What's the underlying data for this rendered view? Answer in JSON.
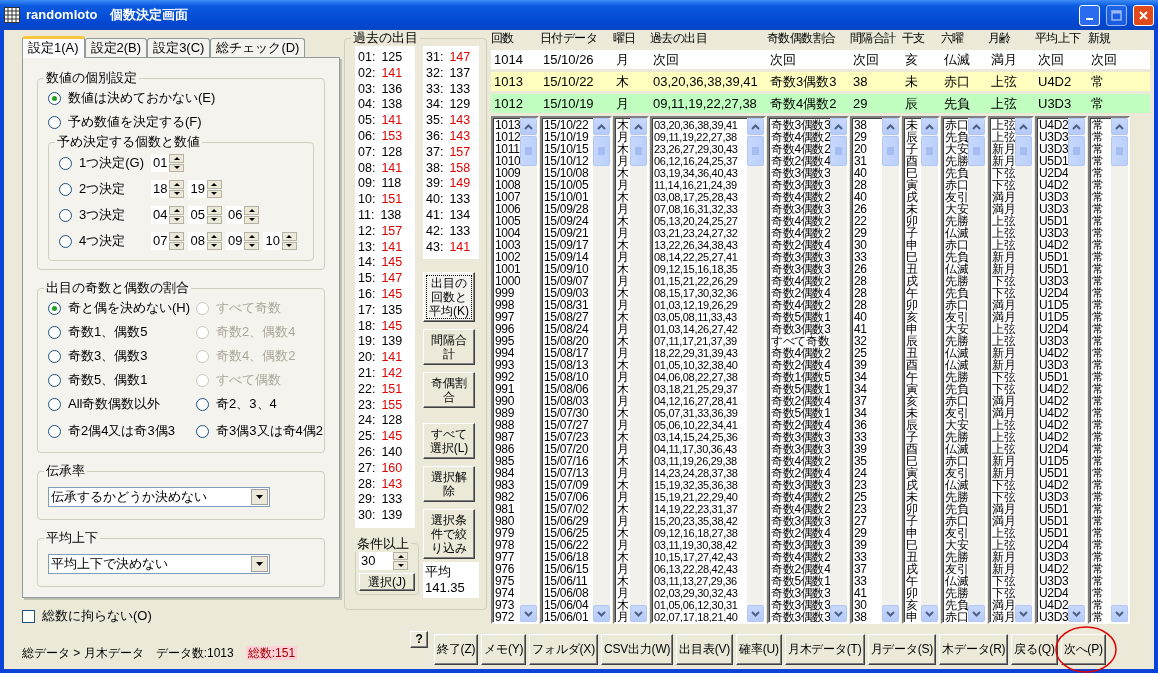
{
  "window": {
    "title": "randomloto　個数決定画面"
  },
  "tabs": [
    {
      "label": "設定1(A)",
      "selected": true
    },
    {
      "label": "設定2(B)",
      "selected": false
    },
    {
      "label": "設定3(C)",
      "selected": false
    },
    {
      "label": "総チェック(D)",
      "selected": false
    }
  ],
  "individual_settings": {
    "title": "数値の個別設定",
    "options": [
      {
        "label": "数値は決めておかない(E)",
        "checked": true
      },
      {
        "label": "予め数値を決定する(F)",
        "checked": false
      }
    ],
    "preset": {
      "title": "予め決定する個数と数値",
      "rows": [
        {
          "label": "1つ決定(G)",
          "checked": false,
          "values": [
            "01"
          ]
        },
        {
          "label": "2つ決定",
          "checked": false,
          "values": [
            "18",
            "19"
          ]
        },
        {
          "label": "3つ決定",
          "checked": false,
          "values": [
            "04",
            "05",
            "06"
          ]
        },
        {
          "label": "4つ決定",
          "checked": false,
          "values": [
            "07",
            "08",
            "09",
            "10"
          ]
        }
      ]
    }
  },
  "odd_even": {
    "title": "出目の奇数と偶数の割合",
    "options": [
      {
        "label": "奇と偶を決めない(H)",
        "checked": true,
        "disabled": false
      },
      {
        "label": "すべて奇数",
        "checked": false,
        "disabled": true
      },
      {
        "label": "奇数1、偶数5",
        "checked": false,
        "disabled": false
      },
      {
        "label": "奇数2、偶数4",
        "checked": false,
        "disabled": true
      },
      {
        "label": "奇数3、偶数3",
        "checked": false,
        "disabled": false
      },
      {
        "label": "奇数4、偶数2",
        "checked": false,
        "disabled": true
      },
      {
        "label": "奇数5、偶数1",
        "checked": false,
        "disabled": false
      },
      {
        "label": "すべて偶数",
        "checked": false,
        "disabled": true
      },
      {
        "label": "All奇数偶数以外",
        "checked": false,
        "disabled": false
      },
      {
        "label": "奇2、3、4",
        "checked": false,
        "disabled": false
      },
      {
        "label": "奇2偶4又は奇3偶3",
        "checked": false,
        "disabled": false
      },
      {
        "label": "奇3偶3又は奇4偶2",
        "checked": false,
        "disabled": false
      }
    ]
  },
  "inheritance": {
    "title": "伝承率",
    "value": "伝承するかどうか決めない"
  },
  "average_updown": {
    "title": "平均上下",
    "value": "平均上下で決めない"
  },
  "ignore_total": {
    "label": "総数に拘らない(O)",
    "checked": false
  },
  "status": {
    "path": "総データ > 月木データ",
    "data_count": "データ数:1013",
    "total": "総数:151"
  },
  "past_numbers": {
    "title": "過去の出目",
    "left_items": [
      {
        "label": "01:",
        "value": "125",
        "high": false
      },
      {
        "label": "02:",
        "value": "141",
        "high": true
      },
      {
        "label": "03:",
        "value": "136",
        "high": false
      },
      {
        "label": "04:",
        "value": "138",
        "high": false
      },
      {
        "label": "05:",
        "value": "141",
        "high": true
      },
      {
        "label": "06:",
        "value": "153",
        "high": true
      },
      {
        "label": "07:",
        "value": "128",
        "high": false
      },
      {
        "label": "08:",
        "value": "141",
        "high": true
      },
      {
        "label": "09:",
        "value": "118",
        "high": false
      },
      {
        "label": "10:",
        "value": "151",
        "high": true
      },
      {
        "label": "11:",
        "value": "138",
        "high": false
      },
      {
        "label": "12:",
        "value": "157",
        "high": true
      },
      {
        "label": "13:",
        "value": "141",
        "high": true
      },
      {
        "label": "14:",
        "value": "145",
        "high": true
      },
      {
        "label": "15:",
        "value": "147",
        "high": true
      },
      {
        "label": "16:",
        "value": "145",
        "high": true
      },
      {
        "label": "17:",
        "value": "135",
        "high": false
      },
      {
        "label": "18:",
        "value": "145",
        "high": true
      },
      {
        "label": "19:",
        "value": "139",
        "high": false
      },
      {
        "label": "20:",
        "value": "141",
        "high": true
      },
      {
        "label": "21:",
        "value": "142",
        "high": true
      },
      {
        "label": "22:",
        "value": "151",
        "high": true
      },
      {
        "label": "23:",
        "value": "155",
        "high": true
      },
      {
        "label": "24:",
        "value": "128",
        "high": false
      },
      {
        "label": "25:",
        "value": "145",
        "high": true
      },
      {
        "label": "26:",
        "value": "140",
        "high": false
      },
      {
        "label": "27:",
        "value": "160",
        "high": true
      },
      {
        "label": "28:",
        "value": "143",
        "high": true
      },
      {
        "label": "29:",
        "value": "133",
        "high": false
      },
      {
        "label": "30:",
        "value": "139",
        "high": false
      }
    ],
    "right_items": [
      {
        "label": "31:",
        "value": "147",
        "high": true
      },
      {
        "label": "32:",
        "value": "137",
        "high": false
      },
      {
        "label": "33:",
        "value": "133",
        "high": false
      },
      {
        "label": "34:",
        "value": "129",
        "high": false
      },
      {
        "label": "35:",
        "value": "143",
        "high": true
      },
      {
        "label": "36:",
        "value": "143",
        "high": true
      },
      {
        "label": "37:",
        "value": "157",
        "high": true
      },
      {
        "label": "38:",
        "value": "158",
        "high": true
      },
      {
        "label": "39:",
        "value": "149",
        "high": true
      },
      {
        "label": "40:",
        "value": "133",
        "high": false
      },
      {
        "label": "41:",
        "value": "134",
        "high": false
      },
      {
        "label": "42:",
        "value": "133",
        "high": false
      },
      {
        "label": "43:",
        "value": "141",
        "high": true
      }
    ]
  },
  "side_buttons": [
    {
      "label": "出目の回数と平均(K)",
      "focused": true
    },
    {
      "label": "間隔合計",
      "focused": false
    },
    {
      "label": "奇偶割合",
      "focused": false
    },
    {
      "label": "すべて選択(L)",
      "focused": false
    },
    {
      "label": "選択解除",
      "focused": false
    },
    {
      "label": "選択条件で絞り込み",
      "focused": false
    }
  ],
  "threshold": {
    "title": "条件以上",
    "value": "30",
    "button": "選択(J)"
  },
  "average": {
    "label": "平均",
    "value": "141.35"
  },
  "table": {
    "columns": [
      "回数",
      "日付データ",
      "曜日",
      "過去の出目",
      "奇数偶数割合",
      "間隔合計",
      "干支",
      "六曜",
      "月齢",
      "平均上下",
      "新規"
    ],
    "top_rows": [
      {
        "color": "#ffffff",
        "cells": [
          "1014",
          "15/10/26",
          "月",
          "次回",
          "次回",
          "次回",
          "亥",
          "仏滅",
          "満月",
          "次回",
          "次回"
        ]
      },
      {
        "color": "#ffffc0",
        "cells": [
          "1013",
          "15/10/22",
          "木",
          "03,20,36,38,39,41",
          "奇数3偶数3",
          "38",
          "未",
          "赤口",
          "上弦",
          "U4D2",
          "常"
        ]
      },
      {
        "color": "#c0ffc0",
        "cells": [
          "1012",
          "15/10/19",
          "月",
          "09,11,19,22,27,38",
          "奇数4偶数2",
          "29",
          "辰",
          "先負",
          "上弦",
          "U3D3",
          "常"
        ]
      }
    ],
    "rows": [
      [
        "1013",
        "15/10/22",
        "木",
        "03,20,36,38,39,41",
        "奇数3偶数3",
        "38",
        "未",
        "赤口",
        "上弦",
        "U4D2",
        "常"
      ],
      [
        "1012",
        "15/10/19",
        "月",
        "09,11,19,22,27,38",
        "奇数4偶数2",
        "29",
        "辰",
        "先負",
        "上弦",
        "U3D3",
        "常"
      ],
      [
        "1011",
        "15/10/15",
        "木",
        "23,26,27,29,30,43",
        "奇数4偶数2",
        "20",
        "子",
        "大安",
        "新月",
        "U3D3",
        "常"
      ],
      [
        "1010",
        "15/10/12",
        "月",
        "06,12,16,24,25,37",
        "奇数2偶数4",
        "31",
        "酉",
        "先勝",
        "新月",
        "U5D1",
        "常"
      ],
      [
        "1009",
        "15/10/08",
        "木",
        "03,19,34,36,40,43",
        "奇数3偶数3",
        "40",
        "巳",
        "先負",
        "下弦",
        "U2D4",
        "常"
      ],
      [
        "1008",
        "15/10/05",
        "月",
        "11,14,16,21,24,39",
        "奇数3偶数3",
        "28",
        "寅",
        "赤口",
        "下弦",
        "U4D2",
        "常"
      ],
      [
        "1007",
        "15/10/01",
        "木",
        "03,08,17,25,28,43",
        "奇数4偶数2",
        "40",
        "戌",
        "友引",
        "満月",
        "U3D3",
        "常"
      ],
      [
        "1006",
        "15/09/28",
        "月",
        "07,08,16,31,32,33",
        "奇数3偶数3",
        "26",
        "未",
        "大安",
        "満月",
        "U3D3",
        "常"
      ],
      [
        "1005",
        "15/09/24",
        "木",
        "05,13,20,24,25,27",
        "奇数4偶数2",
        "22",
        "卯",
        "先勝",
        "上弦",
        "U5D1",
        "常"
      ],
      [
        "1004",
        "15/09/21",
        "月",
        "03,21,23,24,27,32",
        "奇数4偶数2",
        "29",
        "子",
        "仏滅",
        "上弦",
        "U3D3",
        "常"
      ],
      [
        "1003",
        "15/09/17",
        "木",
        "13,22,26,34,38,43",
        "奇数2偶数4",
        "30",
        "申",
        "赤口",
        "上弦",
        "U4D2",
        "常"
      ],
      [
        "1002",
        "15/09/14",
        "月",
        "08,14,22,25,27,41",
        "奇数3偶数3",
        "33",
        "巳",
        "先負",
        "新月",
        "U5D1",
        "常"
      ],
      [
        "1001",
        "15/09/10",
        "木",
        "09,12,15,16,18,35",
        "奇数3偶数3",
        "26",
        "丑",
        "仏滅",
        "新月",
        "U5D1",
        "常"
      ],
      [
        "1000",
        "15/09/07",
        "月",
        "01,15,21,22,26,29",
        "奇数4偶数2",
        "28",
        "戌",
        "先勝",
        "下弦",
        "U3D3",
        "常"
      ],
      [
        "999",
        "15/09/03",
        "木",
        "08,15,17,30,32,36",
        "奇数2偶数4",
        "28",
        "午",
        "先負",
        "下弦",
        "U2D4",
        "常"
      ],
      [
        "998",
        "15/08/31",
        "月",
        "01,03,12,19,26,29",
        "奇数4偶数2",
        "28",
        "卯",
        "赤口",
        "満月",
        "U1D5",
        "常"
      ],
      [
        "997",
        "15/08/27",
        "木",
        "03,05,08,11,33,43",
        "奇数5偶数1",
        "40",
        "亥",
        "友引",
        "満月",
        "U1D5",
        "常"
      ],
      [
        "996",
        "15/08/24",
        "月",
        "01,03,14,26,27,42",
        "奇数3偶数3",
        "41",
        "申",
        "大安",
        "上弦",
        "U2D4",
        "常"
      ],
      [
        "995",
        "15/08/20",
        "木",
        "07,11,17,21,37,39",
        "すべて奇数",
        "32",
        "辰",
        "先勝",
        "上弦",
        "U3D3",
        "常"
      ],
      [
        "994",
        "15/08/17",
        "月",
        "18,22,29,31,39,43",
        "奇数4偶数2",
        "25",
        "丑",
        "仏滅",
        "新月",
        "U4D2",
        "常"
      ],
      [
        "993",
        "15/08/13",
        "木",
        "01,05,10,32,38,40",
        "奇数2偶数4",
        "39",
        "酉",
        "仏滅",
        "新月",
        "U3D3",
        "常"
      ],
      [
        "992",
        "15/08/10",
        "月",
        "04,06,08,22,27,38",
        "奇数1偶数5",
        "34",
        "午",
        "先勝",
        "下弦",
        "U5D1",
        "常"
      ],
      [
        "991",
        "15/08/06",
        "木",
        "03,18,21,25,29,37",
        "奇数5偶数1",
        "34",
        "寅",
        "先負",
        "下弦",
        "U4D2",
        "常"
      ],
      [
        "990",
        "15/08/03",
        "月",
        "04,12,16,27,28,41",
        "奇数2偶数4",
        "37",
        "亥",
        "赤口",
        "満月",
        "U4D2",
        "常"
      ],
      [
        "989",
        "15/07/30",
        "木",
        "05,07,31,33,36,39",
        "奇数5偶数1",
        "34",
        "未",
        "友引",
        "満月",
        "U4D2",
        "常"
      ],
      [
        "988",
        "15/07/27",
        "月",
        "05,06,10,22,34,41",
        "奇数2偶数4",
        "36",
        "辰",
        "大安",
        "上弦",
        "U4D2",
        "常"
      ],
      [
        "987",
        "15/07/23",
        "木",
        "03,14,15,24,25,36",
        "奇数3偶数3",
        "33",
        "子",
        "先勝",
        "上弦",
        "U4D2",
        "常"
      ],
      [
        "986",
        "15/07/20",
        "月",
        "04,11,17,30,36,43",
        "奇数3偶数3",
        "39",
        "酉",
        "仏滅",
        "上弦",
        "U2D4",
        "常"
      ],
      [
        "985",
        "15/07/16",
        "木",
        "03,11,19,26,29,38",
        "奇数4偶数2",
        "35",
        "巳",
        "赤口",
        "新月",
        "U1D5",
        "常"
      ],
      [
        "984",
        "15/07/13",
        "月",
        "14,23,24,28,37,38",
        "奇数2偶数4",
        "24",
        "寅",
        "友引",
        "新月",
        "U5D1",
        "常"
      ],
      [
        "983",
        "15/07/09",
        "木",
        "15,19,32,35,36,38",
        "奇数3偶数3",
        "23",
        "戌",
        "仏滅",
        "下弦",
        "U4D2",
        "常"
      ],
      [
        "982",
        "15/07/06",
        "月",
        "15,19,21,22,29,40",
        "奇数4偶数2",
        "25",
        "未",
        "先勝",
        "下弦",
        "U3D3",
        "常"
      ],
      [
        "981",
        "15/07/02",
        "木",
        "14,19,22,23,31,37",
        "奇数4偶数2",
        "23",
        "卯",
        "先負",
        "満月",
        "U5D1",
        "常"
      ],
      [
        "980",
        "15/06/29",
        "月",
        "15,20,23,35,38,42",
        "奇数3偶数3",
        "27",
        "子",
        "赤口",
        "満月",
        "U5D1",
        "常"
      ],
      [
        "979",
        "15/06/25",
        "木",
        "09,12,16,18,27,38",
        "奇数2偶数4",
        "29",
        "申",
        "友引",
        "上弦",
        "U5D1",
        "常"
      ],
      [
        "978",
        "15/06/22",
        "月",
        "03,11,19,30,38,42",
        "奇数3偶数3",
        "39",
        "巳",
        "大安",
        "上弦",
        "U2D4",
        "常"
      ],
      [
        "977",
        "15/06/18",
        "木",
        "10,15,17,27,42,43",
        "奇数4偶数2",
        "33",
        "丑",
        "先勝",
        "新月",
        "U3D3",
        "常"
      ],
      [
        "976",
        "15/06/15",
        "月",
        "06,13,22,28,42,43",
        "奇数2偶数4",
        "37",
        "戌",
        "友引",
        "新月",
        "U4D2",
        "常"
      ],
      [
        "975",
        "15/06/11",
        "木",
        "03,11,13,27,29,36",
        "奇数5偶数1",
        "33",
        "午",
        "仏滅",
        "下弦",
        "U3D3",
        "常"
      ],
      [
        "974",
        "15/06/08",
        "月",
        "02,03,29,30,32,43",
        "奇数3偶数3",
        "41",
        "卯",
        "先勝",
        "下弦",
        "U2D4",
        "常"
      ],
      [
        "973",
        "15/06/04",
        "木",
        "01,05,06,12,30,31",
        "奇数3偶数3",
        "30",
        "亥",
        "先負",
        "満月",
        "U4D2",
        "常"
      ],
      [
        "972",
        "15/06/01",
        "月",
        "02,07,17,18,21,40",
        "奇数3偶数3",
        "38",
        "申",
        "赤口",
        "満月",
        "U3D3",
        "常"
      ]
    ]
  },
  "bottom_buttons": [
    {
      "label": "?",
      "kind": "help",
      "circled": false
    },
    {
      "label": "終了(Z)",
      "kind": "command",
      "circled": false
    },
    {
      "label": "メモ(Y)",
      "kind": "command",
      "circled": false
    },
    {
      "label": "フォルダ(X)",
      "kind": "command",
      "circled": false
    },
    {
      "label": "CSV出力(W)",
      "kind": "command",
      "circled": false
    },
    {
      "label": "出目表(V)",
      "kind": "command",
      "circled": false
    },
    {
      "label": "確率(U)",
      "kind": "command",
      "circled": false
    },
    {
      "label": "月木データ(T)",
      "kind": "command",
      "circled": false
    },
    {
      "label": "月データ(S)",
      "kind": "command",
      "circled": false
    },
    {
      "label": "木データ(R)",
      "kind": "command",
      "circled": false
    },
    {
      "label": "戻る(Q)",
      "kind": "command",
      "circled": false
    },
    {
      "label": "次へ(P)",
      "kind": "command",
      "circled": true
    }
  ]
}
